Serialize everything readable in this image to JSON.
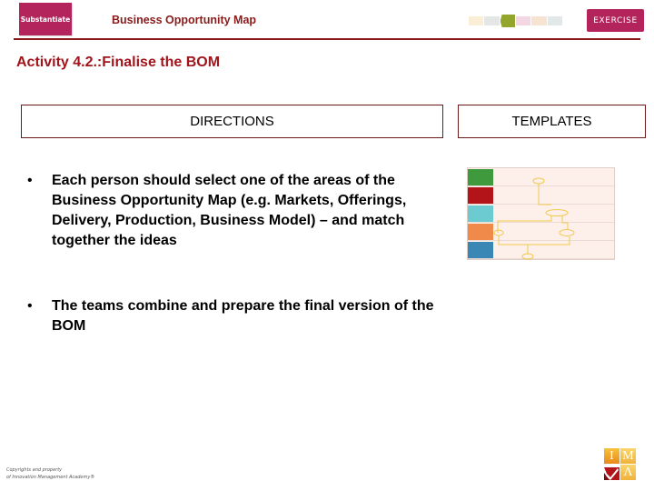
{
  "header": {
    "logo_text": "Substantiate",
    "title": "Business Opportunity Map",
    "exercise_label": "EXERCISE",
    "process_steps": [
      {
        "color": "#fbeed6",
        "active": false
      },
      {
        "color": "#e4e7e6",
        "active": false
      },
      {
        "color": "#93a52a",
        "active": true
      },
      {
        "color": "#f3d7e3",
        "active": false
      },
      {
        "color": "#f7e3d2",
        "active": false
      },
      {
        "color": "#e2e8e8",
        "active": false
      }
    ]
  },
  "activity_title": "Activity 4.2.:Finalise the BOM",
  "directions": {
    "heading": "DIRECTIONS",
    "bullets": [
      "Each person should select one of the areas of the Business Opportunity Map (e.g. Markets, Offerings, Delivery, Production, Business Model) – and match together the ideas",
      "The teams combine and prepare the final version of the BOM"
    ],
    "bullet_glyph": "•"
  },
  "templates": {
    "heading": "TEMPLATES",
    "thumbnail_rows": [
      {
        "color": "#3e9a3c"
      },
      {
        "color": "#b3141a"
      },
      {
        "color": "#6ccbd0"
      },
      {
        "color": "#f08a4b"
      },
      {
        "color": "#3a86b5"
      }
    ],
    "connector_color": "#f2c94c"
  },
  "footer": {
    "copyright_line1": "Copyrights and property",
    "copyright_line2": "of Innovation Management Academy®",
    "ima_logo": {
      "top_left": "I",
      "top_right": "M",
      "bottom_right": "Λ"
    }
  }
}
